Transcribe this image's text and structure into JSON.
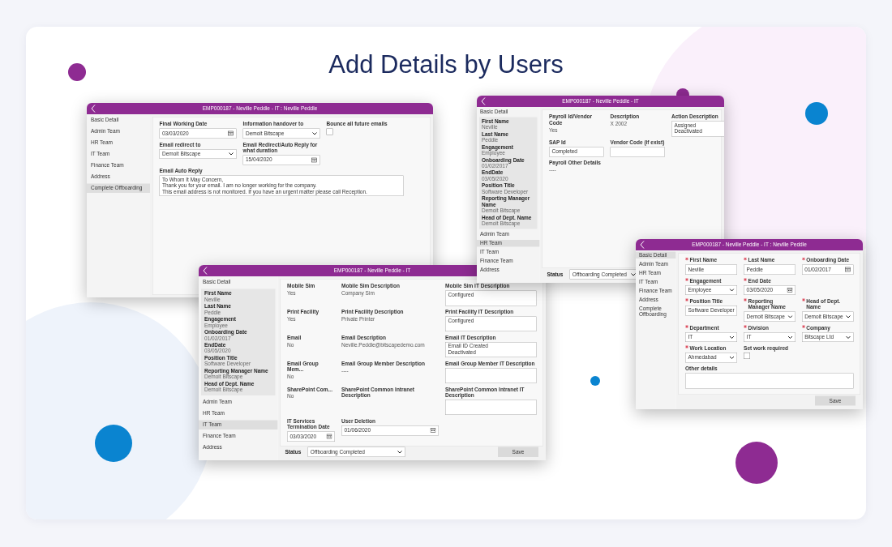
{
  "heading": "Add Details by Users",
  "windows": [
    {
      "title": "EMP000187 - Neville Peddle - IT : Neville Peddle",
      "sidebar": {
        "items": [
          {
            "label": "Basic Detail",
            "selected": false
          },
          {
            "label": "Admin Team",
            "selected": false
          },
          {
            "label": "HR Team",
            "selected": false
          },
          {
            "label": "IT Team",
            "selected": false
          },
          {
            "label": "Finance Team",
            "selected": false
          },
          {
            "label": "Address",
            "selected": false
          },
          {
            "label": "Complete Offboarding",
            "selected": true
          }
        ]
      },
      "form": {
        "fields": [
          {
            "kind": "date",
            "label": "Final Working Date",
            "value": "03/03/2020"
          },
          {
            "kind": "select",
            "label": "Information handover to",
            "value": "Demoit Bitscape"
          },
          {
            "kind": "checkbox",
            "label": "Bounce all future emails",
            "checked": false
          },
          {
            "kind": "select",
            "label": "Email redirect to",
            "value": "Demoit Bitscape"
          },
          {
            "kind": "date",
            "label": "Email Redirect/Auto Reply for what duration",
            "value": "15/04/2020"
          },
          {
            "kind": "gap"
          },
          {
            "kind": "textarea",
            "wide": true,
            "label": "Email Auto Reply",
            "lines": [
              "To Whom It May Concern,",
              "Thank you for your email. I am no longer working for the company.",
              "This email address is not monitored. If you have an urgent matter please call Reception."
            ]
          }
        ]
      }
    },
    {
      "title": "EMP000187 - Neville Peddle - IT",
      "sidebar": {
        "items": [
          {
            "label": "Basic Detail",
            "selected": false
          },
          {
            "label": "Admin Team",
            "selected": false
          },
          {
            "label": "HR Team",
            "selected": false
          },
          {
            "label": "IT Team",
            "selected": true
          },
          {
            "label": "Finance Team",
            "selected": false
          },
          {
            "label": "Address",
            "selected": false
          }
        ],
        "profile": [
          {
            "label": "First Name",
            "value": "Neville"
          },
          {
            "label": "Last Name",
            "value": "Peddle"
          },
          {
            "label": "Engagement",
            "value": "Employee"
          },
          {
            "label": "Onboarding Date",
            "value": "01/02/2017"
          },
          {
            "label": "EndDate",
            "value": "03/05/2020"
          },
          {
            "label": "Position Title",
            "value": "Software Developer"
          },
          {
            "label": "Reporting Manager Name",
            "value": "Demoit Bitscape"
          },
          {
            "label": "Head of Dept. Name",
            "value": "Demoit Bitscape"
          }
        ]
      },
      "form": {
        "fields": [
          {
            "kind": "static",
            "label": "Mobile Sim",
            "value": "Yes"
          },
          {
            "kind": "static",
            "label": "Mobile Sim Description",
            "value": "Company Sim"
          },
          {
            "kind": "textarea",
            "label": "Mobile Sim IT Description",
            "lines": [
              "Configured"
            ]
          },
          {
            "kind": "static",
            "label": "Print Facility",
            "value": "Yes"
          },
          {
            "kind": "static",
            "label": "Print Facility Description",
            "value": "Private Printer"
          },
          {
            "kind": "textarea",
            "label": "Print Facility IT Description",
            "lines": [
              "Configured"
            ]
          },
          {
            "kind": "static",
            "label": "Email",
            "value": "No"
          },
          {
            "kind": "static",
            "label": "Email Description",
            "value": "Neville.Peddle@bitscapedemo.com"
          },
          {
            "kind": "textarea",
            "label": "Email IT Description",
            "lines": [
              "Email ID Created",
              "Deactivated"
            ]
          },
          {
            "kind": "static",
            "label": "Email Group Mem...",
            "value": "No"
          },
          {
            "kind": "static",
            "label": "Email Group Member Description",
            "value": "----"
          },
          {
            "kind": "textarea",
            "label": "Email Group Member IT Description"
          },
          {
            "kind": "static",
            "label": "SharePoint Com...",
            "value": "No"
          },
          {
            "kind": "static",
            "label": "SharePoint Common Intranet Description"
          },
          {
            "kind": "textarea",
            "label": "SharePoint Common Intranet IT Description"
          },
          {
            "kind": "date",
            "label": "IT Services Termination Date",
            "value": "03/03/2020"
          },
          {
            "kind": "date",
            "label": "User Deletion",
            "value": "01/06/2020"
          }
        ]
      },
      "status": {
        "label": "Status",
        "value": "Offboarding Completed"
      },
      "save": "Save"
    },
    {
      "title": "EMP000187 - Neville Peddle - IT",
      "sidebar": {
        "items": [
          {
            "label": "Basic Detail",
            "selected": false
          },
          {
            "label": "Admin Team",
            "selected": false
          },
          {
            "label": "HR Team",
            "selected": true
          },
          {
            "label": "IT Team",
            "selected": false
          },
          {
            "label": "Finance Team",
            "selected": false
          },
          {
            "label": "Address",
            "selected": false
          }
        ],
        "profile": [
          {
            "label": "First Name",
            "value": "Neville"
          },
          {
            "label": "Last Name",
            "value": "Peddle"
          },
          {
            "label": "Engagement",
            "value": "Employee"
          },
          {
            "label": "Onboarding Date",
            "value": "01/02/2017"
          },
          {
            "label": "EndDate",
            "value": "03/05/2020"
          },
          {
            "label": "Position Title",
            "value": "Software Developer"
          },
          {
            "label": "Reporting Manager Name",
            "value": "Demoit Bitscape"
          },
          {
            "label": "Head of Dept. Name",
            "value": "Demoit Bitscape"
          }
        ]
      },
      "form": {
        "fields": [
          {
            "kind": "static",
            "label": "Payroll Id/Vendor Code",
            "value": "Yes"
          },
          {
            "kind": "static",
            "label": "Description",
            "value": "X 2002"
          },
          {
            "kind": "textarea",
            "label": "Action Description",
            "lines": [
              "Assigned",
              "Deactivated"
            ]
          },
          {
            "kind": "input",
            "label": "SAP Id",
            "value": "Completed"
          },
          {
            "kind": "input",
            "label": "Vendor Code (if exist)"
          },
          {
            "kind": "gap"
          },
          {
            "kind": "static",
            "label": "Payroll Other Details",
            "value": "----"
          }
        ]
      },
      "status": {
        "label": "Status",
        "value": "Offboarding Completed"
      }
    },
    {
      "title": "EMP000187 - Neville Peddle - IT : Neville Peddle",
      "sidebar": {
        "items": [
          {
            "label": "Basic Detail",
            "selected": true
          },
          {
            "label": "Admin Team",
            "selected": false
          },
          {
            "label": "HR Team",
            "selected": false
          },
          {
            "label": "IT Team",
            "selected": false
          },
          {
            "label": "Finance Team",
            "selected": false
          },
          {
            "label": "Address",
            "selected": false
          },
          {
            "label": "Complete Offboarding",
            "selected": false
          }
        ]
      },
      "form": {
        "fields": [
          {
            "kind": "input",
            "required": true,
            "label": "First Name",
            "value": "Neville"
          },
          {
            "kind": "input",
            "required": true,
            "label": "Last Name",
            "value": "Peddle"
          },
          {
            "kind": "date",
            "required": true,
            "label": "Onboarding Date",
            "value": "01/02/2017"
          },
          {
            "kind": "select",
            "required": true,
            "label": "Engagement",
            "value": "Employee"
          },
          {
            "kind": "date",
            "required": true,
            "label": "End Date",
            "value": "03/05/2020"
          },
          {
            "kind": "gap"
          },
          {
            "kind": "input",
            "required": true,
            "label": "Position Title",
            "value": "Software Developer"
          },
          {
            "kind": "select",
            "required": true,
            "label": "Reporting Manager Name",
            "value": "Demoit Bitscape"
          },
          {
            "kind": "select",
            "required": true,
            "label": "Head of Dept. Name",
            "value": "Demoit Bitscape"
          },
          {
            "kind": "select",
            "required": true,
            "label": "Department",
            "value": "IT"
          },
          {
            "kind": "select",
            "required": true,
            "label": "Division",
            "value": "IT"
          },
          {
            "kind": "select",
            "required": true,
            "label": "Company",
            "value": "Bitscape Ltd"
          },
          {
            "kind": "select",
            "required": true,
            "label": "Work Location",
            "value": "Ahmedabad"
          },
          {
            "kind": "checkbox",
            "label": "Set work required",
            "checked": false
          },
          {
            "kind": "gap"
          },
          {
            "kind": "textarea",
            "wide": true,
            "label": "Other details"
          }
        ]
      },
      "save": "Save"
    }
  ]
}
